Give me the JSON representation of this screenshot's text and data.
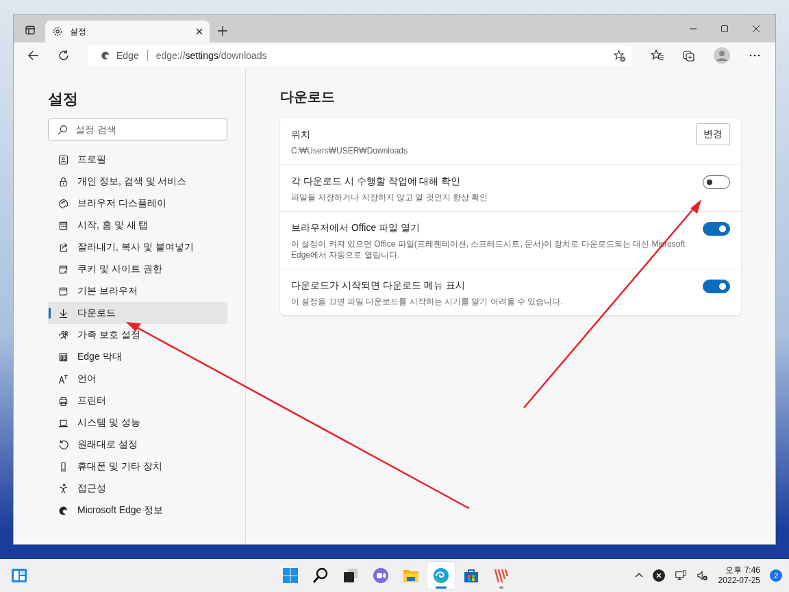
{
  "window": {
    "tab_title": "설정"
  },
  "toolbar": {
    "address_label": "Edge",
    "url_parts": [
      {
        "text": "edge://",
        "strong": false
      },
      {
        "text": "settings",
        "strong": true
      },
      {
        "text": "/downloads",
        "strong": false
      }
    ]
  },
  "sidebar": {
    "title": "설정",
    "search": {
      "placeholder": "설정 검색"
    },
    "items": [
      {
        "label": "프로필",
        "selected": false
      },
      {
        "label": "개인 정보, 검색 및 서비스",
        "selected": false
      },
      {
        "label": "브라우저 디스플레이",
        "selected": false
      },
      {
        "label": "시작, 홈 및 새 탭",
        "selected": false
      },
      {
        "label": "잘라내기, 복사 및 붙여넣기",
        "selected": false
      },
      {
        "label": "쿠키 및 사이트 권한",
        "selected": false
      },
      {
        "label": "기본 브라우저",
        "selected": false
      },
      {
        "label": "다운로드",
        "selected": true
      },
      {
        "label": "가족 보호 설정",
        "selected": false
      },
      {
        "label": "Edge 막대",
        "selected": false
      },
      {
        "label": "언어",
        "selected": false
      },
      {
        "label": "프린터",
        "selected": false
      },
      {
        "label": "시스템 및 성능",
        "selected": false
      },
      {
        "label": "원래대로 설정",
        "selected": false
      },
      {
        "label": "휴대폰 및 기타 장치",
        "selected": false
      },
      {
        "label": "접근성",
        "selected": false
      },
      {
        "label": "Microsoft Edge 정보",
        "selected": false
      }
    ]
  },
  "page": {
    "title": "다운로드",
    "settings": [
      {
        "kind": "button",
        "title": "위치",
        "description": "C:₩Users₩USER₩Downloads",
        "button": "변경"
      },
      {
        "kind": "toggle",
        "title": "각 다운로드 시 수행할 작업에 대해 확인",
        "description": "파일을 저장하거나 저장하지 않고 열 것인지 항상 확인",
        "on": false
      },
      {
        "kind": "toggle",
        "title": "브라우저에서 Office 파일 열기",
        "description": "이 설정이 켜져 있으면 Office 파일(프레젠테이션, 스프레드시트, 문서)이 장치로 다운로드되는 대신 Microsoft Edge에서 자동으로 열립니다.",
        "on": true
      },
      {
        "kind": "toggle",
        "title": "다운로드가 시작되면 다운로드 메뉴 표시",
        "description": "이 설정을 끄면 파일 다운로드를 시작하는 시기를 알기 어려울 수 있습니다.",
        "on": true
      }
    ]
  },
  "taskbar": {
    "apps": [
      {
        "selected": false,
        "running": false
      },
      {
        "selected": false,
        "running": false
      },
      {
        "selected": false,
        "running": false
      },
      {
        "selected": false,
        "running": false
      },
      {
        "selected": false,
        "running": false
      },
      {
        "selected": true,
        "running": true
      },
      {
        "selected": false,
        "running": false
      },
      {
        "selected": false,
        "running": true
      }
    ],
    "clock": {
      "time": "오후 7:46",
      "date": "2022-07-25"
    },
    "notification_count": "2"
  }
}
